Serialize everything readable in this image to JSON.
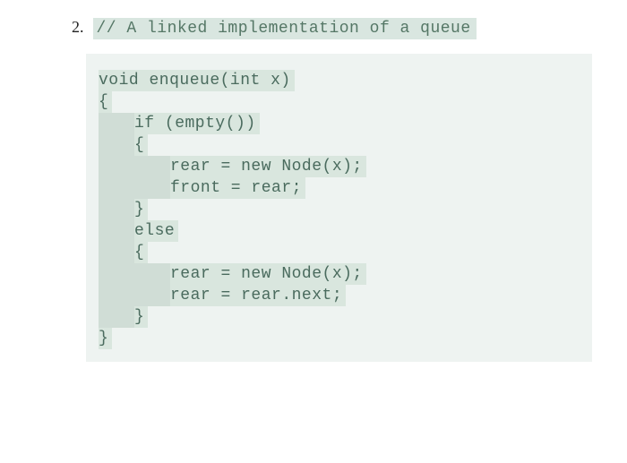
{
  "item_number": "2.",
  "comment": "// A linked implementation of a queue",
  "code": {
    "line1": "void enqueue(int x)",
    "line2": "{",
    "line3": "if (empty())",
    "line4": "{",
    "line5": "rear = new Node(x);",
    "line6": "front = rear;",
    "line7": "}",
    "line8": "else",
    "line9": "{",
    "line10": "rear = new Node(x);",
    "line11": "rear = rear.next;",
    "line12": "}",
    "line13": "}"
  }
}
